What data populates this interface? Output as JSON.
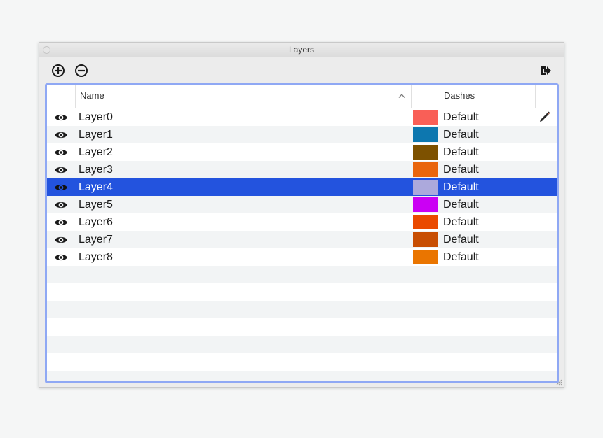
{
  "window": {
    "title": "Layers"
  },
  "toolbar": {
    "add_icon": "plus-circle-icon",
    "remove_icon": "minus-circle-icon",
    "export_icon": "export-arrow-icon"
  },
  "table": {
    "columns": {
      "name": "Name",
      "dashes": "Dashes"
    },
    "sort": "ascending",
    "rows": [
      {
        "name": "Layer0",
        "color": "#f95f57",
        "dashes": "Default",
        "visible": true,
        "active": true
      },
      {
        "name": "Layer1",
        "color": "#0d77af",
        "dashes": "Default",
        "visible": true
      },
      {
        "name": "Layer2",
        "color": "#7d5100",
        "dashes": "Default",
        "visible": true
      },
      {
        "name": "Layer3",
        "color": "#e9650d",
        "dashes": "Default",
        "visible": true
      },
      {
        "name": "Layer4",
        "color": "#aca9dc",
        "dashes": "Default",
        "visible": true,
        "selected": true
      },
      {
        "name": "Layer5",
        "color": "#cb00f4",
        "dashes": "Default",
        "visible": true
      },
      {
        "name": "Layer6",
        "color": "#ea4a00",
        "dashes": "Default",
        "visible": true
      },
      {
        "name": "Layer7",
        "color": "#c84e03",
        "dashes": "Default",
        "visible": true
      },
      {
        "name": "Layer8",
        "color": "#ea7500",
        "dashes": "Default",
        "visible": true
      }
    ],
    "empty_rows": 6
  },
  "colors": {
    "selection": "#2353de",
    "focus_ring": "#8fa8f4",
    "alt_row": "#f2f4f5"
  }
}
